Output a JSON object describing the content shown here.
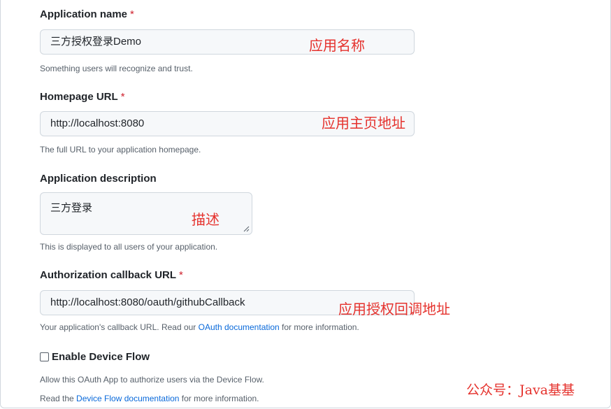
{
  "app_name": {
    "label": "Application name",
    "required_mark": "*",
    "value": "三方授权登录Demo",
    "hint": "Something users will recognize and trust.",
    "annotation": "应用名称"
  },
  "homepage": {
    "label": "Homepage URL",
    "required_mark": "*",
    "value": "http://localhost:8080",
    "hint": "The full URL to your application homepage.",
    "annotation": "应用主页地址"
  },
  "description": {
    "label": "Application description",
    "value": "三方登录",
    "hint": "This is displayed to all users of your application.",
    "annotation": "描述"
  },
  "callback": {
    "label": "Authorization callback URL",
    "required_mark": "*",
    "value": "http://localhost:8080/oauth/githubCallback",
    "hint_prefix": "Your application's callback URL. Read our ",
    "hint_link": "OAuth documentation",
    "hint_suffix": " for more information.",
    "annotation": "应用授权回调地址"
  },
  "device_flow": {
    "label": "Enable Device Flow",
    "checked": false,
    "hint_line1": "Allow this OAuth App to authorize users via the Device Flow.",
    "hint_line2_prefix": "Read the ",
    "hint_line2_link": "Device Flow documentation",
    "hint_line2_suffix": " for more information."
  },
  "watermark": "公众号：Java基基",
  "colors": {
    "annotation_red": "#e5322d",
    "link_blue": "#0969da",
    "required_red": "#cf222e"
  }
}
